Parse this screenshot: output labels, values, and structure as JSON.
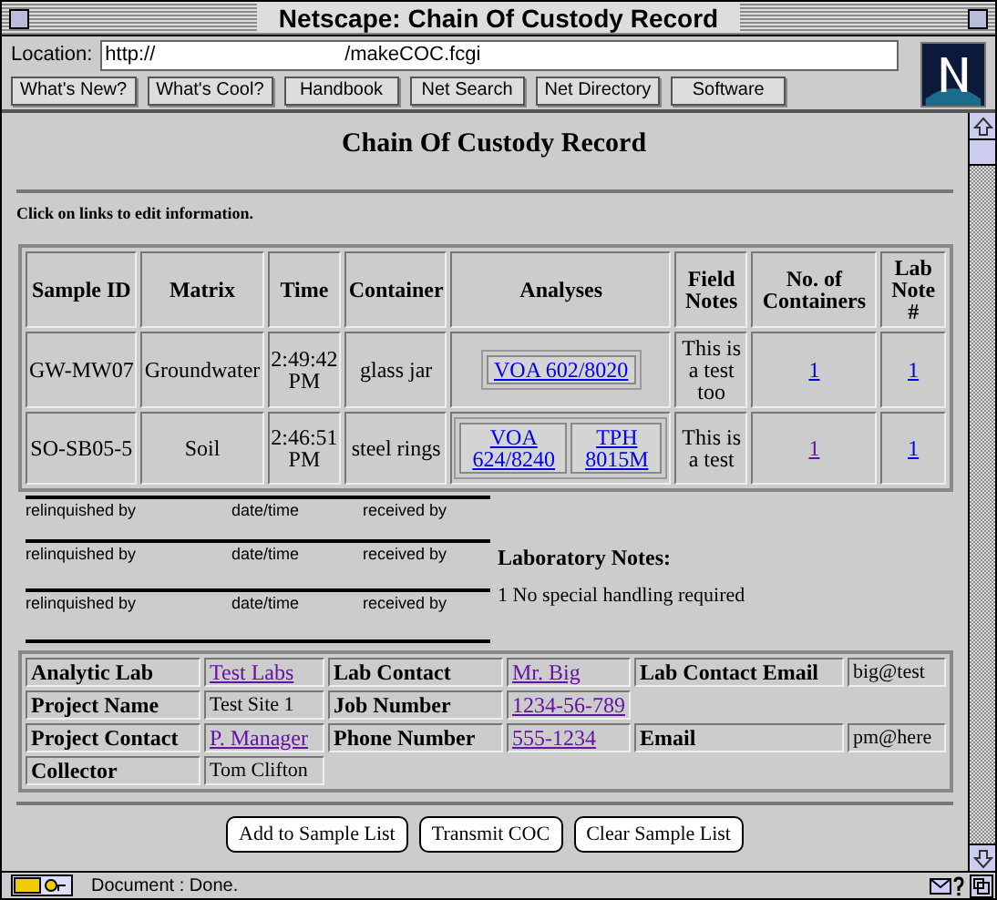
{
  "window": {
    "title": "Netscape: Chain Of Custody Record"
  },
  "location": {
    "label": "Location:",
    "value": "http://                                  /makeCOC.fcgi"
  },
  "nav_buttons": [
    "What's New?",
    "What's Cool?",
    "Handbook",
    "Net Search",
    "Net Directory",
    "Software"
  ],
  "page": {
    "heading": "Chain Of Custody Record",
    "instruction": "Click on links to edit information.",
    "table": {
      "columns": [
        "Sample ID",
        "Matrix",
        "Time",
        "Container",
        "Analyses",
        "Field Notes",
        "No. of Containers",
        "Lab Note #"
      ],
      "rows": [
        {
          "sample_id": "GW-MW07",
          "matrix": "Groundwater",
          "time": "2:49:42 PM",
          "container": "glass jar",
          "analyses": [
            {
              "text": "VOA 602/8020",
              "visited": false
            }
          ],
          "field_notes": "This is a test too",
          "containers": {
            "text": "1",
            "visited": false
          },
          "lab_note": {
            "text": "1",
            "visited": false
          }
        },
        {
          "sample_id": "SO-SB05-5",
          "matrix": "Soil",
          "time": "2:46:51 PM",
          "container": "steel rings",
          "analyses": [
            {
              "text": "VOA 624/8240",
              "visited": false
            },
            {
              "text": "TPH 8015M",
              "visited": false
            }
          ],
          "field_notes": "This is a test",
          "containers": {
            "text": "1",
            "visited": true
          },
          "lab_note": {
            "text": "1",
            "visited": false
          }
        }
      ]
    },
    "signature_rows": [
      {
        "relinquished": "relinquished by",
        "datetime": "date/time",
        "received": "received by"
      },
      {
        "relinquished": "relinquished by",
        "datetime": "date/time",
        "received": "received by"
      },
      {
        "relinquished": "relinquished by",
        "datetime": "date/time",
        "received": "received by"
      }
    ],
    "lab_notes": {
      "heading": "Laboratory Notes:",
      "notes": [
        "1 No special handling required"
      ]
    },
    "info": [
      [
        {
          "kind": "label",
          "text": "Analytic Lab"
        },
        {
          "kind": "link",
          "text": "Test Labs",
          "visited": true
        },
        {
          "kind": "label",
          "text": "Lab Contact"
        },
        {
          "kind": "link",
          "text": "Mr. Big",
          "visited": true
        },
        {
          "kind": "label",
          "text": "Lab Contact Email"
        },
        {
          "kind": "text",
          "text": "big@test"
        }
      ],
      [
        {
          "kind": "label",
          "text": "Project Name"
        },
        {
          "kind": "text",
          "text": "Test Site 1"
        },
        {
          "kind": "label",
          "text": "Job Number"
        },
        {
          "kind": "link",
          "text": "1234-56-789",
          "visited": true
        }
      ],
      [
        {
          "kind": "label",
          "text": "Project Contact"
        },
        {
          "kind": "link",
          "text": "P. Manager",
          "visited": true
        },
        {
          "kind": "label",
          "text": "Phone Number"
        },
        {
          "kind": "link",
          "text": "555-1234",
          "visited": true
        },
        {
          "kind": "label",
          "text": "Email"
        },
        {
          "kind": "text",
          "text": "pm@here"
        }
      ],
      [
        {
          "kind": "label",
          "text": "Collector"
        },
        {
          "kind": "text",
          "text": "Tom Clifton"
        }
      ]
    ],
    "buttons": [
      "Add to Sample List",
      "Transmit COC",
      "Clear Sample List"
    ]
  },
  "status_bar": {
    "text": "Document : Done."
  }
}
